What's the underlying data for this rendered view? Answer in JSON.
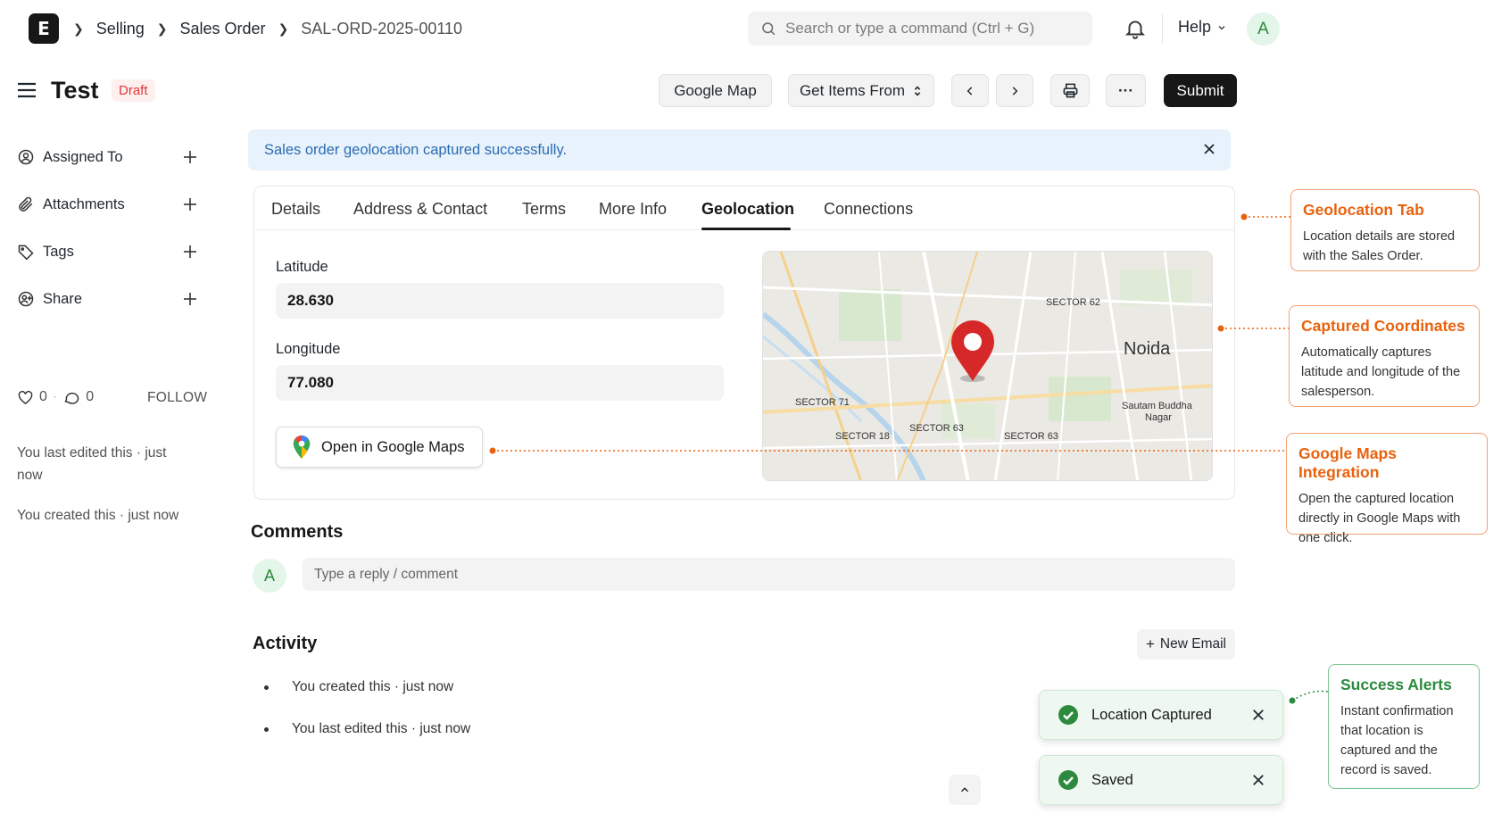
{
  "topbar": {
    "logo_letter": "E",
    "breadcrumbs": [
      "Selling",
      "Sales Order",
      "SAL-ORD-2025-00110"
    ],
    "search_placeholder": "Search or type a command (Ctrl + G)",
    "help_label": "Help",
    "avatar_initial": "A"
  },
  "title_bar": {
    "title": "Test",
    "status": "Draft",
    "google_map_label": "Google Map",
    "get_items_label": "Get Items From",
    "more_label": "···",
    "submit_label": "Submit"
  },
  "sidebar": {
    "items": [
      {
        "label": "Assigned To"
      },
      {
        "label": "Attachments"
      },
      {
        "label": "Tags"
      },
      {
        "label": "Share"
      }
    ],
    "likes_count": "0",
    "comments_count": "0",
    "follow_label": "FOLLOW",
    "last_edited": "You last edited this · just now",
    "created": "You created this · just now"
  },
  "alert": {
    "message": "Sales order geolocation captured successfully."
  },
  "tabs": [
    {
      "label": "Details"
    },
    {
      "label": "Address & Contact"
    },
    {
      "label": "Terms"
    },
    {
      "label": "More Info"
    },
    {
      "label": "Geolocation",
      "active": true
    },
    {
      "label": "Connections"
    }
  ],
  "geolocation": {
    "latitude_label": "Latitude",
    "latitude_value": "28.630",
    "longitude_label": "Longitude",
    "longitude_value": "77.080",
    "open_maps_label": "Open in Google Maps"
  },
  "map": {
    "labels": {
      "sector62": "SECTOR 62",
      "noida": "Noida",
      "sector71": "SECTOR 71",
      "sautam1": "Sautam Buddha",
      "sautam2": "Nagar",
      "sector63a": "SECTOR 63",
      "sector18": "SECTOR 18",
      "sector63b": "SECTOR 63"
    }
  },
  "callouts": [
    {
      "title": "Geolocation Tab",
      "body": "Location details are stored with the Sales Order."
    },
    {
      "title": "Captured Coordinates",
      "body": "Automatically captures latitude and longitude of the salesperson."
    },
    {
      "title": "Google Maps Integration",
      "body": "Open the captured location directly in Google Maps with one click."
    },
    {
      "title": "Success Alerts",
      "body": "Instant confirmation that location is captured and the record is saved."
    }
  ],
  "comments": {
    "heading": "Comments",
    "avatar_initial": "A",
    "placeholder": "Type a reply / comment"
  },
  "activity": {
    "heading": "Activity",
    "new_email_label": "New Email",
    "items": [
      "You created this · just now",
      "You last edited this · just now"
    ]
  },
  "toasts": [
    {
      "message": "Location Captured"
    },
    {
      "message": "Saved"
    }
  ],
  "colors": {
    "accent_orange": "#e8620e",
    "success_green": "#2b8a3e",
    "alert_blue": "#2b6cb0",
    "map_pin_red": "#d62828"
  }
}
